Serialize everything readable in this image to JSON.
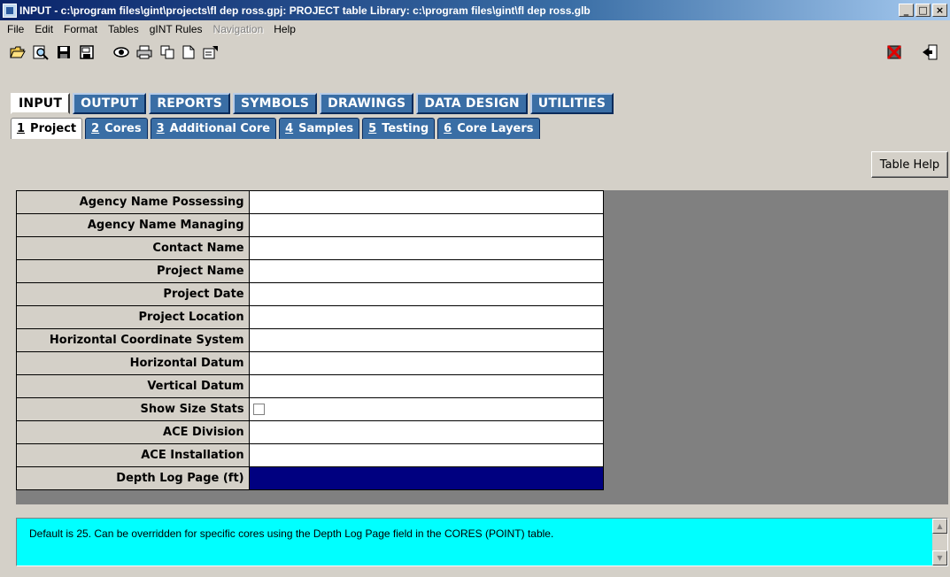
{
  "window": {
    "title": "INPUT -  c:\\program files\\gint\\projects\\fl dep ross.gpj: PROJECT table    Library: c:\\program files\\gint\\fl dep ross.glb",
    "minimize": "_",
    "maximize": "□",
    "close": "×"
  },
  "menu": [
    {
      "label": "File",
      "disabled": false
    },
    {
      "label": "Edit",
      "disabled": false
    },
    {
      "label": "Format",
      "disabled": false
    },
    {
      "label": "Tables",
      "disabled": false
    },
    {
      "label": "gINT Rules",
      "disabled": false
    },
    {
      "label": "Navigation",
      "disabled": true
    },
    {
      "label": "Help",
      "disabled": false
    }
  ],
  "toolbar": {
    "icons": [
      "open-folder-icon",
      "search-icon",
      "save-icon",
      "save-as-icon",
      "preview-icon",
      "print-icon",
      "copy-icon",
      "new-document-icon",
      "properties-icon",
      "delete-record-icon",
      "exit-icon"
    ]
  },
  "main_tabs": [
    "INPUT",
    "OUTPUT",
    "REPORTS",
    "SYMBOLS",
    "DRAWINGS",
    "DATA DESIGN",
    "UTILITIES"
  ],
  "main_tabs_active": "INPUT",
  "sub_tabs": [
    {
      "num": "1",
      "label": "Project",
      "active": true
    },
    {
      "num": "2",
      "label": "Cores",
      "active": false
    },
    {
      "num": "3",
      "label": "Additional Core",
      "active": false
    },
    {
      "num": "4",
      "label": "Samples",
      "active": false
    },
    {
      "num": "5",
      "label": "Testing",
      "active": false
    },
    {
      "num": "6",
      "label": "Core Layers",
      "active": false
    }
  ],
  "table_help_label": "Table Help",
  "fields": [
    {
      "label": "Agency Name Possessing",
      "value": "",
      "type": "text"
    },
    {
      "label": "Agency Name Managing",
      "value": "",
      "type": "text"
    },
    {
      "label": "Contact Name",
      "value": "",
      "type": "text"
    },
    {
      "label": "Project Name",
      "value": "",
      "type": "text"
    },
    {
      "label": "Project Date",
      "value": "",
      "type": "text"
    },
    {
      "label": "Project Location",
      "value": "",
      "type": "text"
    },
    {
      "label": "Horizontal Coordinate System",
      "value": "",
      "type": "text"
    },
    {
      "label": "Horizontal Datum",
      "value": "",
      "type": "text"
    },
    {
      "label": "Vertical Datum",
      "value": "",
      "type": "text"
    },
    {
      "label": "Show Size Stats",
      "value": "",
      "type": "checkbox",
      "checked": false
    },
    {
      "label": "ACE Division",
      "value": "",
      "type": "text"
    },
    {
      "label": "ACE Installation",
      "value": "",
      "type": "text"
    },
    {
      "label": "Depth Log Page (ft)",
      "value": "",
      "type": "text",
      "selected": true
    }
  ],
  "help_text": "Default is 25.  Can be overridden for specific cores using the Depth Log Page field in the CORES (POINT) table.",
  "colors": {
    "tab_blue": "#3a6ea5",
    "selected_cell": "#000080",
    "help_background": "#00ffff"
  }
}
